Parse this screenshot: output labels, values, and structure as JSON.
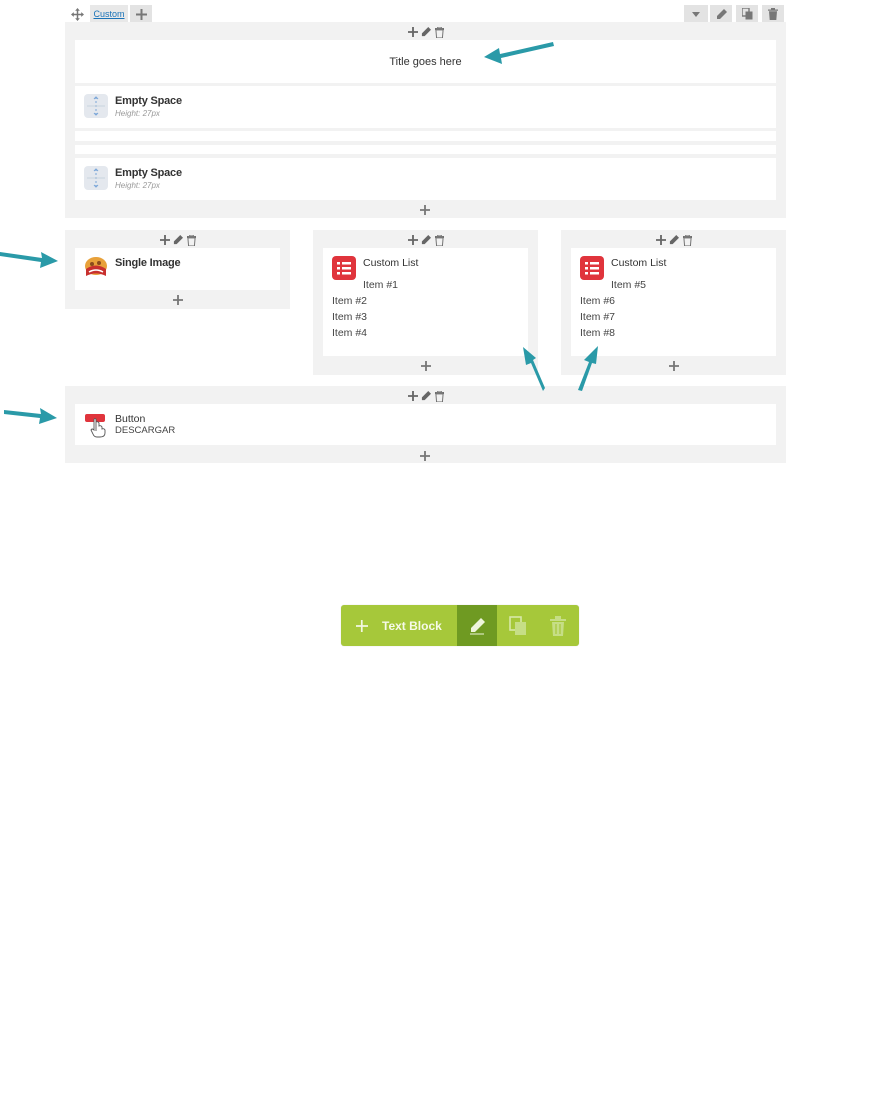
{
  "top_bar": {
    "label": "Custom",
    "move_icon": "move-icon",
    "add_icon": "plus-icon",
    "toggle_icon": "caret-down-icon",
    "edit_icon": "pencil-icon",
    "clone_icon": "copy-icon",
    "delete_icon": "trash-icon"
  },
  "row1": {
    "title_text": "Title goes here",
    "empty_space_1": {
      "title": "Empty Space",
      "subtitle": "Height: 27px"
    },
    "empty_space_2": {
      "title": "Empty Space",
      "subtitle": "Height: 27px"
    }
  },
  "row2": {
    "col1": {
      "title": "Single Image"
    },
    "col2": {
      "title": "Custom List",
      "items": [
        "Item #1",
        "Item #2",
        "Item #3",
        "Item #4"
      ]
    },
    "col3": {
      "title": "Custom List",
      "items": [
        "Item #5",
        "Item #6",
        "Item #7",
        "Item #8"
      ]
    }
  },
  "row3": {
    "button": {
      "title": "Button",
      "subtitle": "DESCARGAR"
    }
  },
  "text_block_bar": {
    "label": "Text Block",
    "bg_color": "#a6c83a",
    "active_color": "#6f9a22"
  },
  "colors": {
    "arrow": "#2a9aa8",
    "panel": "#f2f2f2",
    "list_icon": "#e0343c"
  }
}
